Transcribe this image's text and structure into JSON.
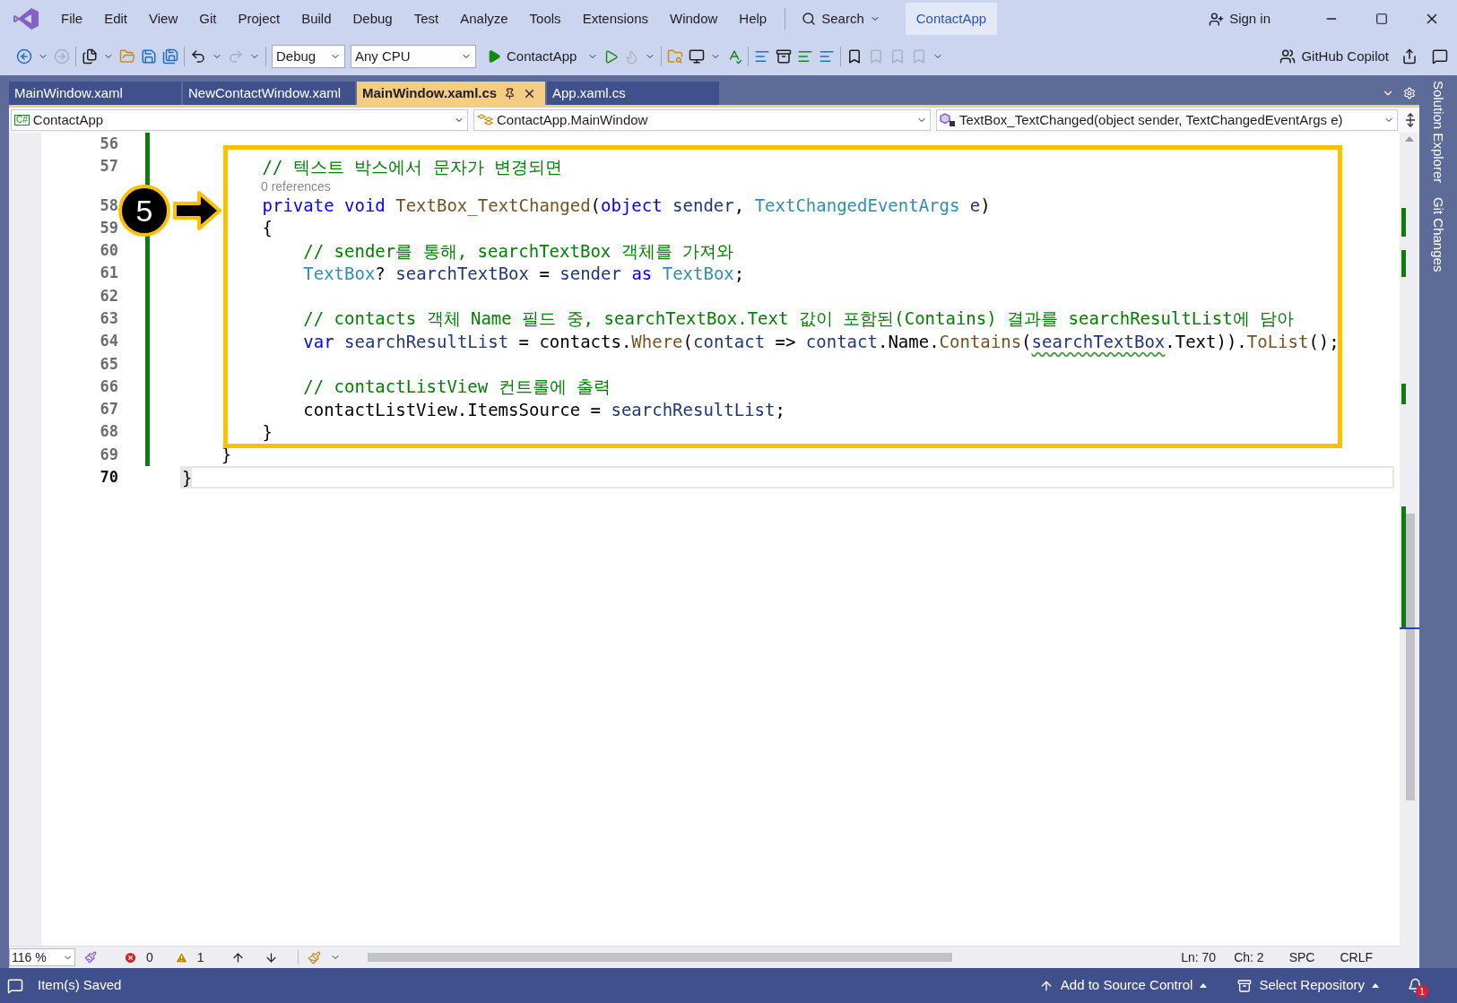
{
  "menu": [
    "File",
    "Edit",
    "View",
    "Git",
    "Project",
    "Build",
    "Debug",
    "Test",
    "Analyze",
    "Tools",
    "Extensions",
    "Window",
    "Help"
  ],
  "search": {
    "label": "Search"
  },
  "solution_name": "ContactApp",
  "sign_in": "Sign in",
  "toolbar": {
    "configuration": "Debug",
    "platform": "Any CPU",
    "start_target": "ContactApp",
    "copilot": "GitHub Copilot"
  },
  "tabs": [
    {
      "label": "MainWindow.xaml",
      "selected": false
    },
    {
      "label": "NewContactWindow.xaml",
      "selected": false
    },
    {
      "label": "MainWindow.xaml.cs",
      "selected": true
    },
    {
      "label": "App.xaml.cs",
      "selected": false
    }
  ],
  "nav_bar": {
    "project_badge": "C#",
    "project": "ContactApp",
    "type": "ContactApp.MainWindow",
    "member": "TextBox_TextChanged(object sender, TextChangedEventArgs e)"
  },
  "side_tabs": [
    "Solution Explorer",
    "Git Changes"
  ],
  "code_lines": [
    {
      "kind": "code",
      "number": "56",
      "changed": true,
      "current": false
    },
    {
      "kind": "code",
      "number": "57",
      "changed": true,
      "current": false,
      "tokens": [
        {
          "text": "        // 텍스트 박스에서 문자가 변경되면",
          "kind": "comment"
        }
      ]
    },
    {
      "kind": "codelens",
      "changed": true,
      "text": "0 references"
    },
    {
      "kind": "code",
      "number": "58",
      "current": false,
      "tokens": [
        {
          "text": "        private",
          "kind": "keyword"
        },
        {
          "text": " void",
          "kind": "keyword"
        },
        {
          "text": " TextBox_TextChanged",
          "kind": "method"
        },
        {
          "text": "(",
          "kind": "plain"
        },
        {
          "text": "object",
          "kind": "keyword"
        },
        {
          "text": " sender",
          "kind": "local"
        },
        {
          "text": ", ",
          "kind": "plain"
        },
        {
          "text": "TextChangedEventArgs",
          "kind": "type"
        },
        {
          "text": " e",
          "kind": "local"
        },
        {
          "text": ")",
          "kind": "plain"
        }
      ]
    },
    {
      "kind": "code",
      "number": "59",
      "changed": true,
      "current": false,
      "tokens": [
        {
          "text": "        {",
          "kind": "plain"
        }
      ]
    },
    {
      "kind": "code",
      "number": "60",
      "changed": true,
      "current": false,
      "tokens": [
        {
          "text": "            // sender를 통해, searchTextBox 객체를 가져와",
          "kind": "comment"
        }
      ]
    },
    {
      "kind": "code",
      "number": "61",
      "changed": true,
      "current": false,
      "tokens": [
        {
          "text": "            TextBox",
          "kind": "type"
        },
        {
          "text": "? ",
          "kind": "plain"
        },
        {
          "text": "searchTextBox",
          "kind": "local"
        },
        {
          "text": " = ",
          "kind": "plain"
        },
        {
          "text": "sender",
          "kind": "local"
        },
        {
          "text": " as",
          "kind": "keyword"
        },
        {
          "text": " TextBox",
          "kind": "type"
        },
        {
          "text": ";",
          "kind": "plain"
        }
      ]
    },
    {
      "kind": "code",
      "number": "62",
      "changed": true,
      "current": false
    },
    {
      "kind": "code",
      "number": "63",
      "changed": true,
      "current": false,
      "tokens": [
        {
          "text": "            // contacts 객체 Name 필드 중, searchTextBox.Text 값이 포함된(Contains) 결과를 searchResultList에 담아",
          "kind": "comment"
        }
      ]
    },
    {
      "kind": "code",
      "number": "64",
      "changed": true,
      "current": false,
      "tokens": [
        {
          "text": "            var",
          "kind": "keyword"
        },
        {
          "text": " searchResultList",
          "kind": "local"
        },
        {
          "text": " = contacts.",
          "kind": "plain"
        },
        {
          "text": "Where",
          "kind": "method"
        },
        {
          "text": "(",
          "kind": "plain"
        },
        {
          "text": "contact",
          "kind": "local"
        },
        {
          "text": " => ",
          "kind": "plain"
        },
        {
          "text": "contact",
          "kind": "local"
        },
        {
          "text": ".Name.",
          "kind": "plain"
        },
        {
          "text": "Contains",
          "kind": "method"
        },
        {
          "text": "(",
          "kind": "plain"
        },
        {
          "text": "searchTextBox",
          "kind": "local",
          "warning": true
        },
        {
          "text": ".Text)).",
          "kind": "plain"
        },
        {
          "text": "ToList",
          "kind": "method"
        },
        {
          "text": "();",
          "kind": "plain"
        }
      ]
    },
    {
      "kind": "code",
      "number": "65",
      "changed": true,
      "current": false
    },
    {
      "kind": "code",
      "number": "66",
      "changed": true,
      "current": false,
      "tokens": [
        {
          "text": "            // contactListView 컨트롤에 출력",
          "kind": "comment"
        }
      ]
    },
    {
      "kind": "code",
      "number": "67",
      "changed": true,
      "current": false,
      "tokens": [
        {
          "text": "            contactListView.ItemsSource = ",
          "kind": "plain"
        },
        {
          "text": "searchResultList",
          "kind": "local"
        },
        {
          "text": ";",
          "kind": "plain"
        }
      ]
    },
    {
      "kind": "code",
      "number": "68",
      "changed": true,
      "current": false,
      "tokens": [
        {
          "text": "        }",
          "kind": "plain"
        }
      ]
    },
    {
      "kind": "code",
      "number": "69",
      "changed": true,
      "current": false,
      "tokens": [
        {
          "text": "    }",
          "kind": "plain"
        }
      ]
    },
    {
      "kind": "code",
      "number": "70",
      "changed": false,
      "current": true,
      "tokens": [
        {
          "text": "}",
          "kind": "plain"
        }
      ]
    }
  ],
  "callout": {
    "number": "5"
  },
  "editor_status": {
    "zoom": "116 %",
    "errors": "0",
    "warnings": "1",
    "line": "Ln: 70",
    "column": "Ch: 2",
    "whitespace": "SPC",
    "line_ending": "CRLF"
  },
  "status_bar": {
    "message": "Item(s) Saved",
    "source_control": "Add to Source Control",
    "repository": "Select Repository",
    "notifications": "1"
  }
}
